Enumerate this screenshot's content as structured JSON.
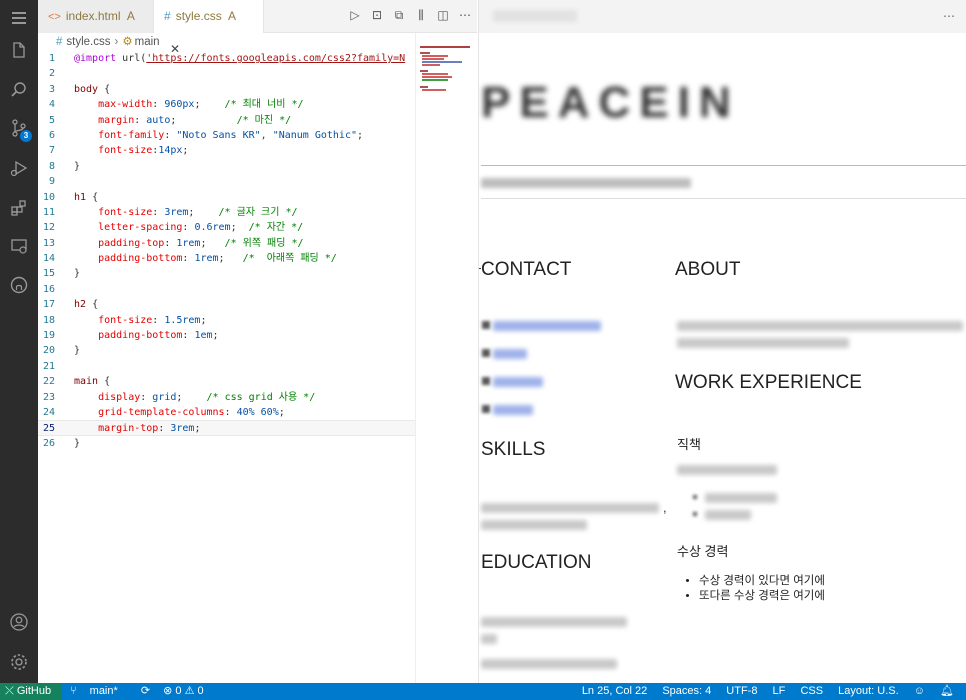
{
  "tabs": [
    {
      "icon": "<>",
      "label": "index.html",
      "badge": "A"
    },
    {
      "icon": "#",
      "label": "style.css",
      "badge": "A"
    }
  ],
  "breadcrumb": {
    "file": "style.css",
    "symbol": "main"
  },
  "code_lines": [
    "@import url('https://fonts.googleapis.com/css2?family=N",
    "",
    "body {",
    "    max-width: 960px;    /* 최대 너비 */",
    "    margin: auto;          /* 마진 */",
    "    font-family: \"Noto Sans KR\", \"Nanum Gothic\";",
    "    font-size:14px;",
    "}",
    "",
    "h1 {",
    "    font-size: 3rem;    /* 글자 크기 */",
    "    letter-spacing: 0.6rem;  /* 자간 */",
    "    padding-top: 1rem;   /* 위쪽 패딩 */",
    "    padding-bottom: 1rem;   /*  아래쪽 패딩 */",
    "}",
    "",
    "h2 {",
    "    font-size: 1.5rem;",
    "    padding-bottom: 1em;",
    "}",
    "",
    "main {",
    "    display: grid;    /* css grid 사용 */",
    "    grid-template-columns: 40% 60%;",
    "    margin-top: 3rem;",
    "}"
  ],
  "current_line": 25,
  "preview": {
    "title": "PEACEIN",
    "sections_left": [
      "CONTACT",
      "SKILLS",
      "EDUCATION"
    ],
    "sections_right": [
      "ABOUT",
      "WORK EXPERIENCE"
    ],
    "job_heading": "직책",
    "awards_heading": "수상 경력",
    "awards": [
      "수상 경력이 있다면 여기에",
      "또다른 수상 경력은 여기에"
    ],
    "comma": ","
  },
  "scm_badge": "3",
  "status": {
    "remote": "GitHub",
    "branch": "main*",
    "problems": "⊗ 0 ⚠ 0",
    "position": "Ln 25, Col 22",
    "spaces": "Spaces: 4",
    "encoding": "UTF-8",
    "eol": "LF",
    "language": "CSS",
    "layout": "Layout: U.S."
  },
  "colors": {
    "activity_bg": "#2c2c2c",
    "status_bg": "#007acc",
    "selector": "#800000",
    "property": "#e50000",
    "value": "#0451a5",
    "comment": "#008000",
    "keyword": "#af00db"
  }
}
